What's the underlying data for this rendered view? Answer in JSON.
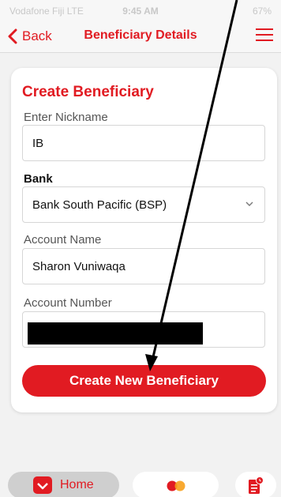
{
  "status_bar": {
    "carrier": "Vodafone Fiji  LTE",
    "time": "9:45 AM",
    "right": "67%"
  },
  "nav": {
    "back_label": "Back",
    "title": "Beneficiary Details"
  },
  "form": {
    "title": "Create Beneficiary",
    "nickname_label": "Enter Nickname",
    "nickname_value": "IB",
    "bank_label": "Bank",
    "bank_value": "Bank South Pacific (BSP)",
    "account_name_label": "Account Name",
    "account_name_value": "Sharon Vuniwaqa",
    "account_number_label": "Account Number",
    "submit_label": "Create New Beneficiary"
  },
  "tabs": {
    "home_label": "Home"
  },
  "colors": {
    "accent": "#e11b22",
    "background": "#f2f2f2"
  }
}
